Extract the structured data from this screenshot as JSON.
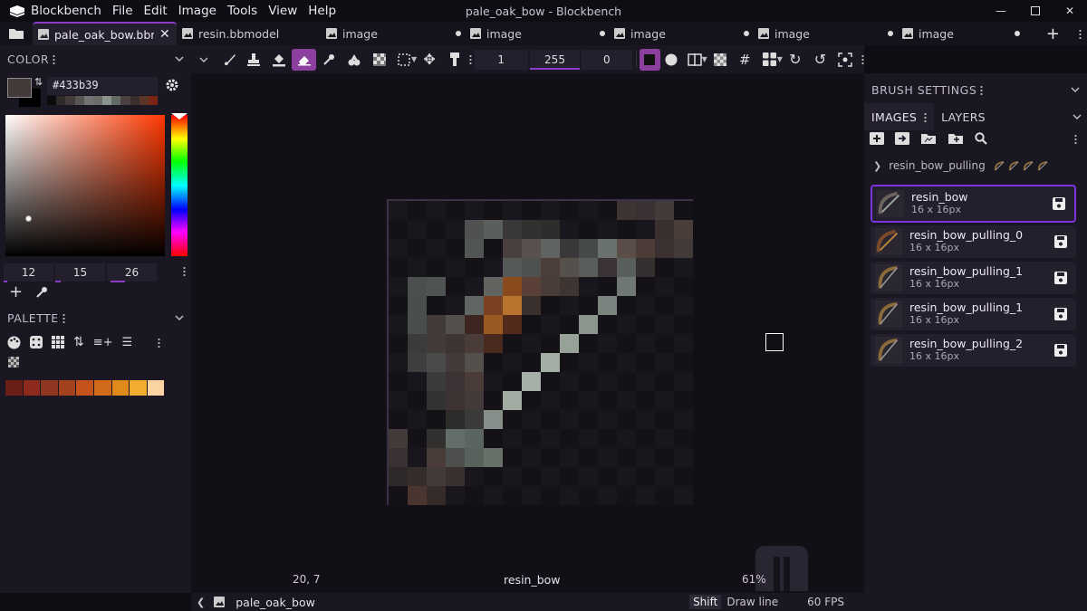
{
  "titlebar": {
    "app_name": "Blockbench",
    "menu": [
      "File",
      "Edit",
      "Image",
      "Tools",
      "View",
      "Help"
    ],
    "window_title": "pale_oak_bow - Blockbench",
    "controls": [
      "minimize-icon",
      "maximize-icon",
      "close-icon"
    ]
  },
  "tabs": [
    {
      "label": "pale_oak_bow.bbmodel",
      "active": true,
      "icon": "image-icon",
      "closable": true
    },
    {
      "label": "resin.bbmodel",
      "active": false,
      "icon": "image-icon"
    },
    {
      "label": "image",
      "active": false,
      "icon": "image-icon",
      "unsaved": true
    },
    {
      "label": "image",
      "active": false,
      "icon": "image-icon",
      "unsaved": true
    },
    {
      "label": "image",
      "active": false,
      "icon": "image-icon",
      "unsaved": true
    },
    {
      "label": "image",
      "active": false,
      "icon": "image-icon",
      "unsaved": true
    },
    {
      "label": "image",
      "active": false,
      "icon": "image-icon",
      "unsaved": true
    }
  ],
  "color_panel": {
    "title": "COLOR",
    "hex": "#433b39",
    "recent": [
      "#0b0b0c",
      "#2f2a2a",
      "#433b39",
      "#5a5555",
      "#717473",
      "#6b6d6b",
      "#8a938c",
      "#626a66",
      "#4a4040",
      "#3a2f2d",
      "#5b3528",
      "#7a2416"
    ],
    "rgb": {
      "r": "12",
      "g": "15",
      "b": "26"
    }
  },
  "palette_panel": {
    "title": "PALETTE",
    "colors": [
      "#6b1e16",
      "#8c2a1b",
      "#8f3620",
      "#a3421c",
      "#c4521d",
      "#d16b1b",
      "#e08a1c",
      "#f2ac2f",
      "#f9d3a2"
    ]
  },
  "toolbar": {
    "brush_size": "1",
    "opacity": "255",
    "softness": "0"
  },
  "canvas": {
    "cursor_coords": "20, 7",
    "texture_name": "resin_bow",
    "zoom": "61%"
  },
  "statusbar": {
    "project": "pale_oak_bow",
    "shortcut_key": "Shift",
    "shortcut_action": "Draw line",
    "fps": "60 FPS"
  },
  "right_panel": {
    "brush_settings_title": "BRUSH SETTINGS",
    "tabs": [
      "IMAGES",
      "LAYERS"
    ],
    "folder": "resin_bow_pulling",
    "images": [
      {
        "name": "resin_bow",
        "size": "16 x 16px",
        "selected": true
      },
      {
        "name": "resin_bow_pulling_0",
        "size": "16 x 16px"
      },
      {
        "name": "resin_bow_pulling_1",
        "size": "16 x 16px"
      },
      {
        "name": "resin_bow_pulling_1",
        "size": "16 x 16px"
      },
      {
        "name": "resin_bow_pulling_2",
        "size": "16 x 16px"
      }
    ]
  }
}
